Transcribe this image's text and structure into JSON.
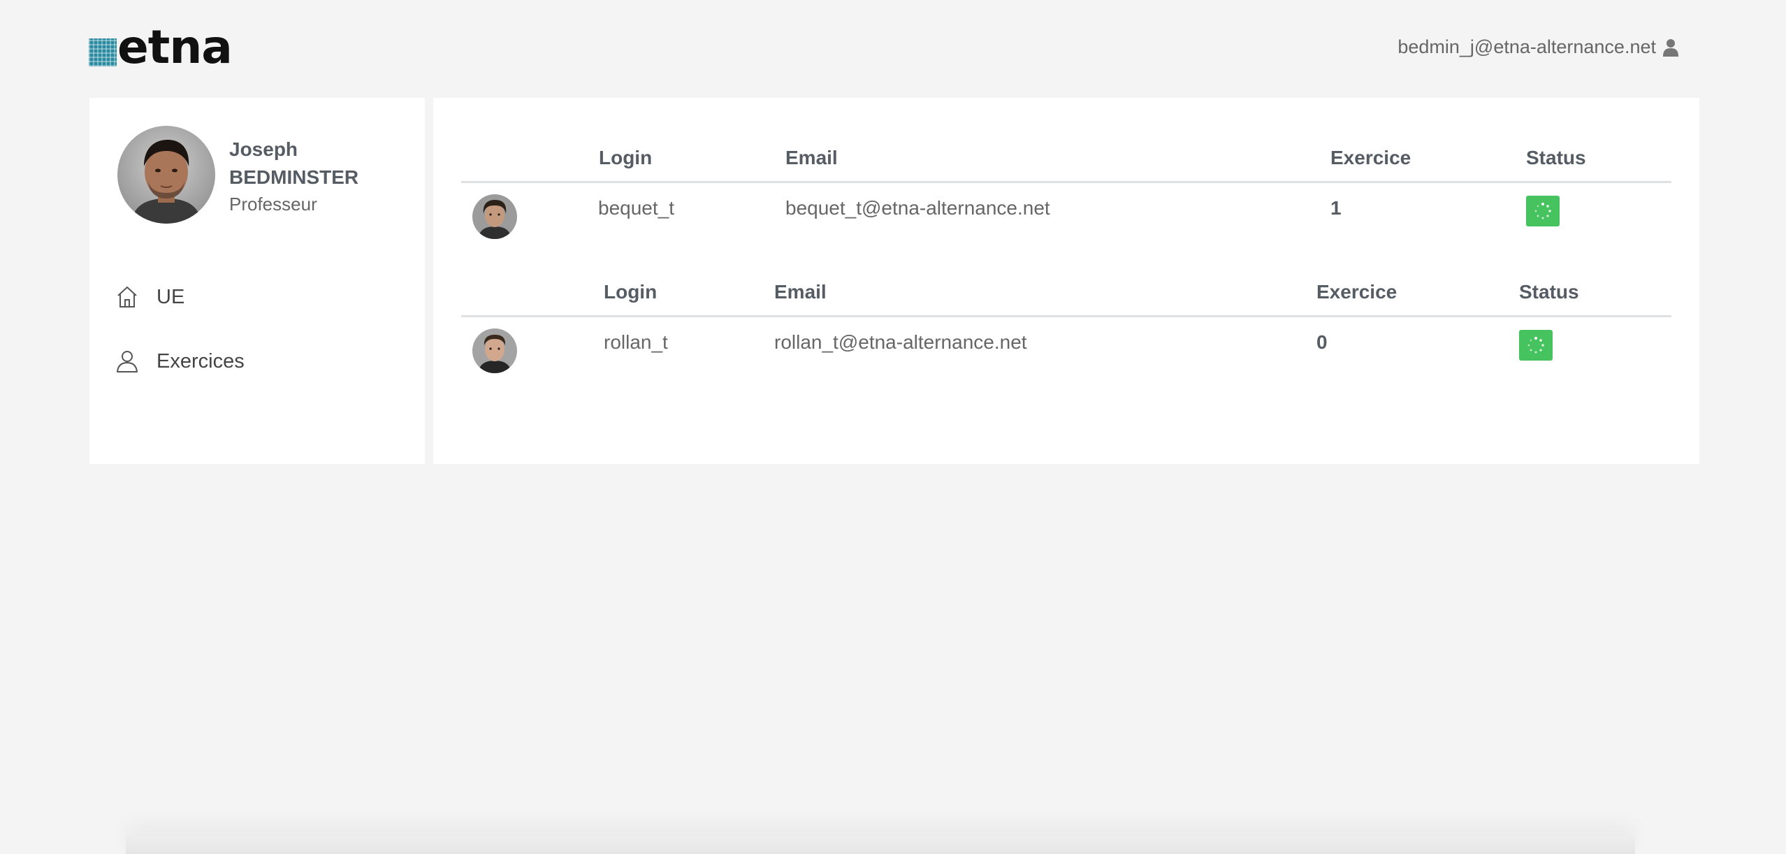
{
  "header": {
    "logo_text": "etna",
    "user_email": "bedmin_j@etna-alternance.net",
    "user_icon": "user-icon"
  },
  "profile": {
    "first_name": "Joseph",
    "last_name": "BEDMINSTER",
    "role": "Professeur"
  },
  "nav": {
    "items": [
      {
        "label": "UE",
        "icon": "home-icon"
      },
      {
        "label": "Exercices",
        "icon": "person-outline-icon"
      }
    ]
  },
  "table1": {
    "headers": {
      "login": "Login",
      "email": "Email",
      "exercice": "Exercice",
      "status": "Status"
    },
    "row": {
      "login": "bequet_t",
      "email": "bequet_t@etna-alternance.net",
      "exercice": "1",
      "status_icon": "spinner-icon"
    }
  },
  "table2": {
    "headers": {
      "login": "Login",
      "email": "Email",
      "exercice": "Exercice",
      "status": "Status"
    },
    "row": {
      "login": "rollan_t",
      "email": "rollan_t@etna-alternance.net",
      "exercice": "0",
      "status_icon": "spinner-icon"
    }
  },
  "colors": {
    "brand": "#2a8aa0",
    "status_green": "#46c35f",
    "panel_bg": "#ffffff",
    "page_bg": "#f4f4f4"
  }
}
